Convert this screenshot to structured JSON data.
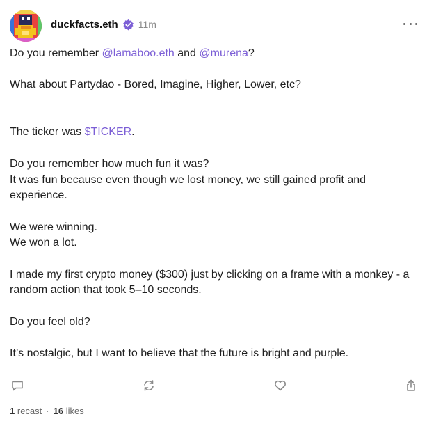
{
  "author": {
    "username": "duckfacts.eth",
    "verified": true,
    "time": "11m"
  },
  "post": {
    "p1": {
      "pre": "Do you remember ",
      "mention1": "@lamaboo.eth",
      "mid": " and ",
      "mention2": "@murena",
      "post": "?"
    },
    "p2": "What about Partydao - Bored, Imagine, Higher, Lower, etc?",
    "p3": {
      "pre": "The ticker was ",
      "ticker": "$TICKER",
      "post": "."
    },
    "p4": [
      "Do you remember how much fun it was?",
      "It was fun because even though we lost money, we still gained profit and experience."
    ],
    "p5": [
      "We were winning.",
      "We won a lot."
    ],
    "p6": "I made my first crypto money ($300) just by clicking on a frame with a monkey - a random action that took 5–10 seconds.",
    "p7": "Do you feel old?",
    "p8": "It’s nostalgic, but I want to believe that the future is bright and purple."
  },
  "actions": {
    "reply": "reply-icon",
    "recast": "recast-icon",
    "like": "heart-icon",
    "share": "share-icon"
  },
  "stats": {
    "recasts_count": "1",
    "recasts_label": "recast",
    "separator": "·",
    "likes_count": "16",
    "likes_label": "likes"
  },
  "colors": {
    "mention": "#7c5fd6",
    "verified": "#7c5fd6",
    "muted": "#8a8a8a"
  }
}
